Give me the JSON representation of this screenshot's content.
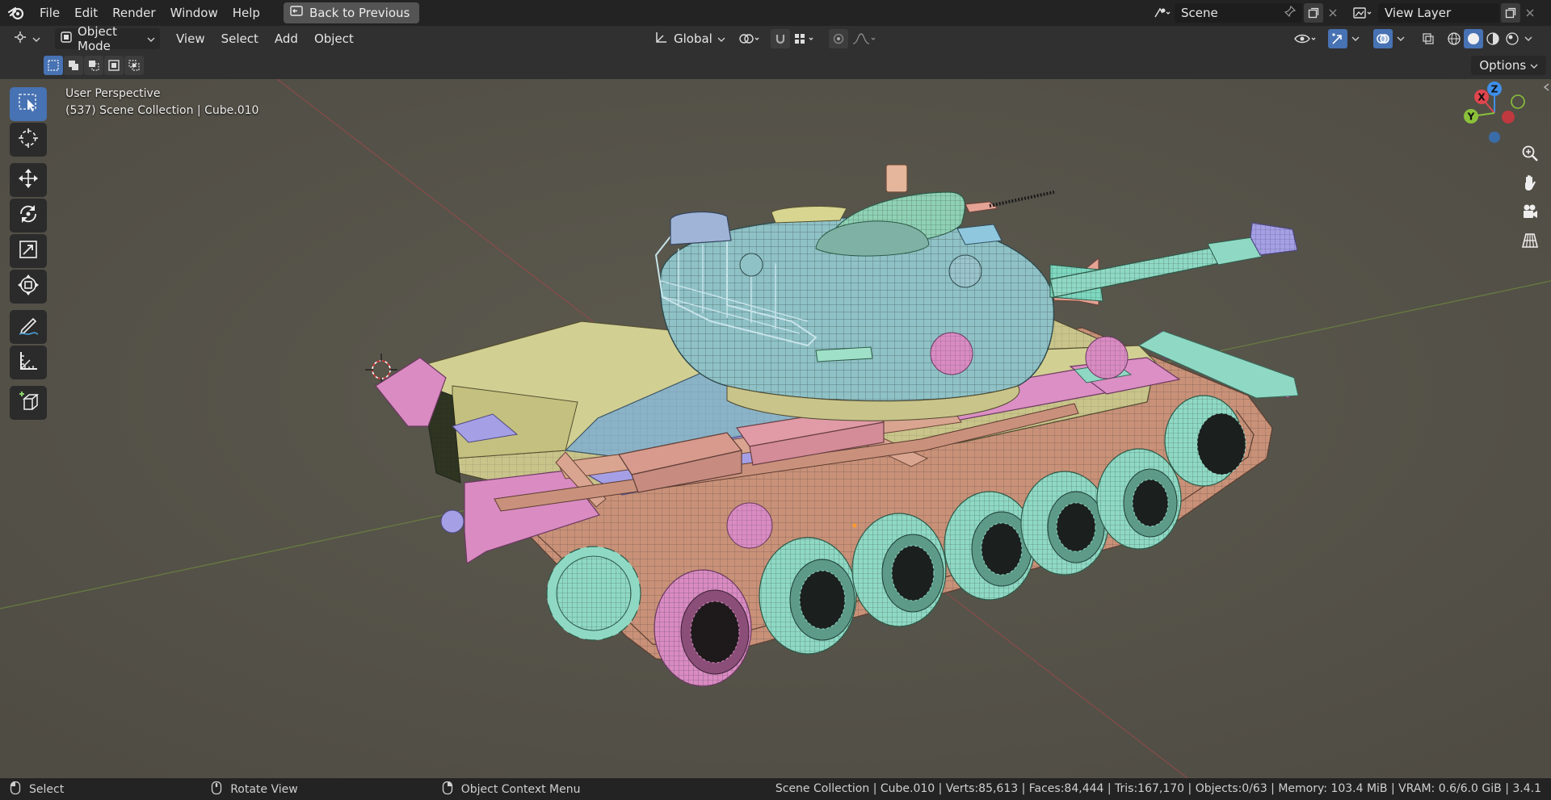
{
  "menu": {
    "file": "File",
    "edit": "Edit",
    "render": "Render",
    "window": "Window",
    "help": "Help",
    "back_to_previous": "Back to Previous"
  },
  "scene": {
    "name": "Scene"
  },
  "view_layer": {
    "name": "View Layer"
  },
  "header": {
    "mode": "Object Mode",
    "view": "View",
    "select": "Select",
    "add": "Add",
    "object": "Object",
    "orientation": "Global",
    "options": "Options"
  },
  "viewport": {
    "perspective_label": "User Perspective",
    "collection_label": "(537) Scene Collection | Cube.010"
  },
  "gizmo": {
    "z": "Z",
    "x": "X",
    "y": "Y"
  },
  "status": {
    "select": "Select",
    "rotate_view": "Rotate View",
    "context_menu": "Object Context Menu",
    "stats": "Scene Collection | Cube.010 | Verts:85,613 | Faces:84,444 | Tris:167,170 | Objects:0/63 | Memory: 103.4 MiB | VRAM: 0.6/6.0 GiB | 3.4.1"
  },
  "colors": {
    "accent": "#4772b3",
    "viewport_bg": "#3d3d3d",
    "axis_x": "#e0464e",
    "axis_y": "#8bc13a",
    "axis_z": "#3f8fe8"
  }
}
